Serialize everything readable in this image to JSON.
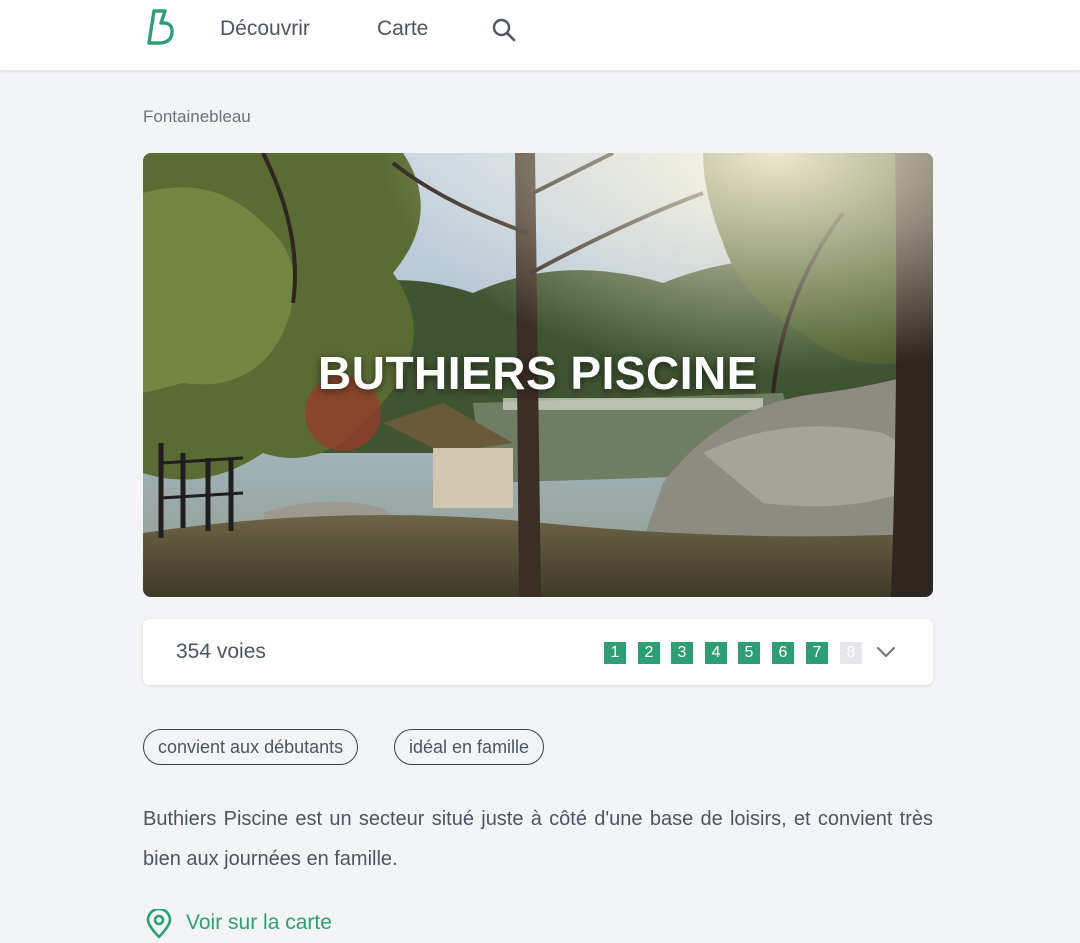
{
  "colors": {
    "accent": "#2e9e74",
    "background": "#f3f4f6",
    "text": "#4b5563"
  },
  "header": {
    "logo_icon": "brand-b-logo",
    "nav": [
      {
        "label": "Découvrir"
      },
      {
        "label": "Carte"
      }
    ],
    "search_icon": "search-icon"
  },
  "breadcrumb": "Fontainebleau",
  "hero": {
    "title": "BUTHIERS PISCINE",
    "image": "forest-boulders-lake-photo"
  },
  "routes": {
    "count_label": "354 voies",
    "grades": [
      {
        "label": "1",
        "active": true
      },
      {
        "label": "2",
        "active": true
      },
      {
        "label": "3",
        "active": true
      },
      {
        "label": "4",
        "active": true
      },
      {
        "label": "5",
        "active": true
      },
      {
        "label": "6",
        "active": true
      },
      {
        "label": "7",
        "active": true
      },
      {
        "label": "8",
        "active": false
      }
    ],
    "expand_icon": "chevron-down-icon"
  },
  "tags": [
    {
      "label": "convient aux débutants"
    },
    {
      "label": "idéal en famille"
    }
  ],
  "description": "Buthiers Piscine est un secteur situé juste à côté d'une base de loisirs, et convient très bien aux journées en famille.",
  "map_link": {
    "label": "Voir sur la carte",
    "icon": "map-pin-icon"
  }
}
